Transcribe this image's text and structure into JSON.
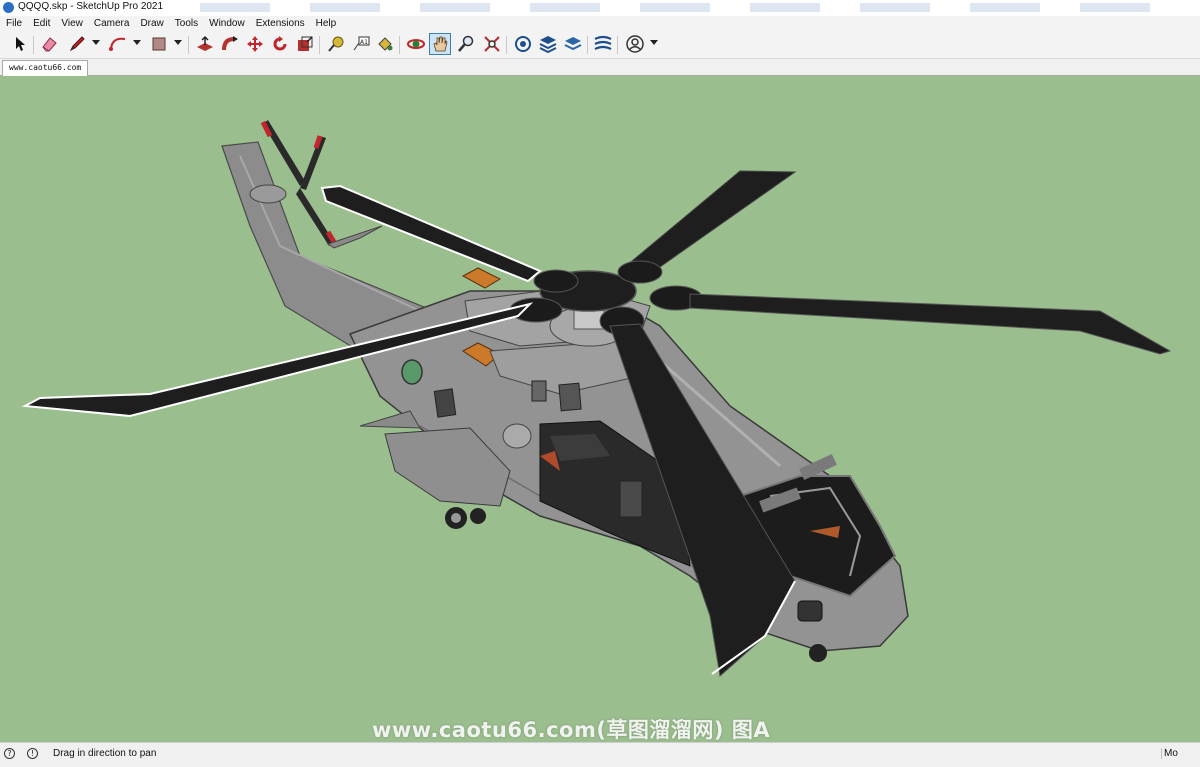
{
  "window": {
    "title": "QQQQ.skp - SketchUp Pro 2021"
  },
  "menu": [
    "File",
    "Edit",
    "View",
    "Camera",
    "Draw",
    "Tools",
    "Window",
    "Extensions",
    "Help"
  ],
  "toolbar": {
    "tools": [
      "select-icon",
      "eraser-icon",
      "pencil-line-icon",
      "arc-icon",
      "rectangle-icon",
      "push-pull-icon",
      "follow-me-icon",
      "move-icon",
      "rotate-icon",
      "scale-icon",
      "tape-measure-icon",
      "text-icon",
      "paint-bucket-icon",
      "orbit-icon",
      "pan-icon",
      "zoom-icon",
      "zoom-extents-icon",
      "warehouse-icon",
      "extension-warehouse-icon",
      "layers-icon",
      "sandbox-icon",
      "account-icon"
    ],
    "active_tool": "pan-icon"
  },
  "scene_tab": {
    "label": "www.caotu66.com"
  },
  "viewport": {
    "background": "#9bbe8e",
    "watermark": "www.caotu66.com(草图溜溜网) 图A"
  },
  "statusbar": {
    "message": "Drag in direction to pan",
    "measurements_label": "Mo"
  }
}
